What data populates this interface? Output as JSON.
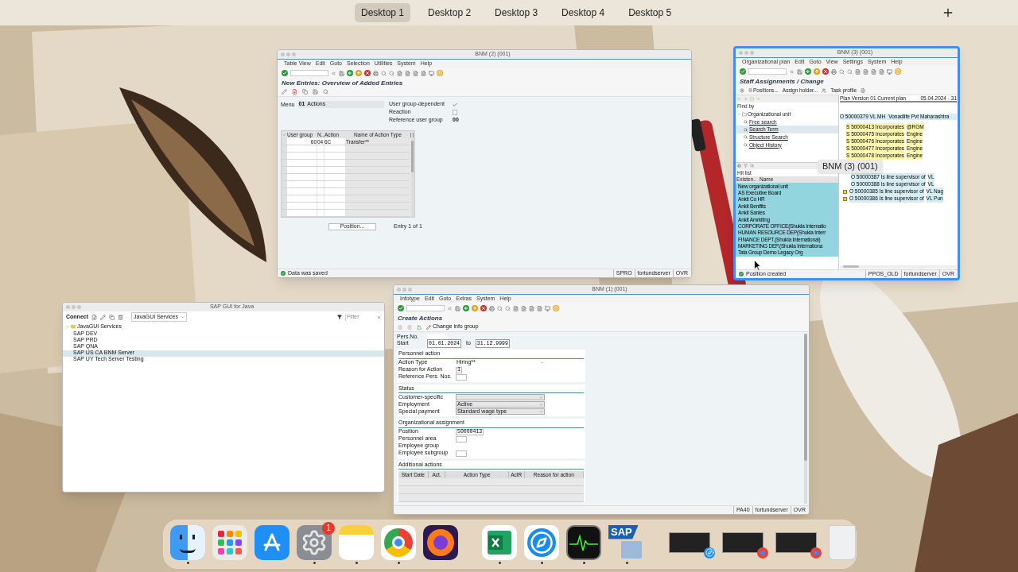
{
  "desktop_bar": {
    "desktops": [
      {
        "label": "Desktop 1",
        "selected": true
      },
      {
        "label": "Desktop 2",
        "selected": false
      },
      {
        "label": "Desktop 3",
        "selected": false
      },
      {
        "label": "Desktop 4",
        "selected": false
      },
      {
        "label": "Desktop 5",
        "selected": false
      }
    ]
  },
  "table_view_window": {
    "title": "BNM (2) (001)",
    "menu": [
      "Table View",
      "Edit",
      "Goto",
      "Selection",
      "Utilities",
      "System",
      "Help"
    ],
    "screen_title": "New Entries: Overview of Added Entries",
    "menu_field": {
      "label": "Menu",
      "code": "01",
      "value": "Actions"
    },
    "options": [
      {
        "kind": "checkbox",
        "label": "User group-dependent",
        "checked": true
      },
      {
        "kind": "checkbox",
        "label": "Reaction",
        "checked": false
      },
      {
        "kind": "text",
        "label": "Reference user group",
        "value": "00"
      }
    ],
    "table": {
      "columns": [
        "User group",
        "N..",
        "Action",
        "Name of Action Type"
      ],
      "rows": [
        [
          "60",
          "04",
          "6C",
          "Transfer**"
        ]
      ]
    },
    "position_button": "Position...",
    "entry_info": "Entry 1 of 1",
    "status_message": "Data was saved",
    "status_items": [
      "SPRO",
      "fortundserver",
      "OVR"
    ]
  },
  "staff_window": {
    "title": "BNM (3) (001)",
    "highlighted": true,
    "hover_label": "BNM (3) (001)",
    "menu": [
      "Organizational plan",
      "Edit",
      "Goto",
      "View",
      "Settings",
      "System",
      "Help"
    ],
    "screen_title": "Staff Assignments / Change",
    "toolbar": [
      "Positions...",
      "Assign holder...",
      "Task profile"
    ],
    "find_by": {
      "heading": "Find by",
      "tree": [
        {
          "label": "Organizational unit",
          "expanded": true,
          "children": [
            {
              "label": "Free search",
              "selected": false
            },
            {
              "label": "Search Term",
              "selected": true
            },
            {
              "label": "Structure Search",
              "selected": false
            },
            {
              "label": "Object History",
              "selected": false
            }
          ]
        }
      ]
    },
    "hit_list": {
      "heading": "Hit list",
      "columns": [
        "Existen..",
        "Name"
      ],
      "rows": [
        "New organizational unit",
        "AS Executive Board",
        "Ankit Co HR",
        "Ankit Benifits",
        "Ankit Sanles",
        "Ankit Amrkiting",
        "CORPORATE OFFICE(Shukla Internatio",
        "HUMAN RESOURCE DEP(Shukla Interr",
        "FINANCE DEPT.(Shukla International)",
        "MARKETING DEP.(Shukla Internationa",
        "Tata Group Demo Legacy Org"
      ]
    },
    "structure": {
      "plan": "Plan Version 01 Current plan",
      "date": "05.04.2024 - 31",
      "root": {
        "type": "O",
        "id": "50000379",
        "short": "VL MH",
        "name": "Vonadlife Pvt Maharashtra"
      },
      "rows": [
        {
          "kind": "position",
          "type": "S",
          "id": "50000413",
          "relation": "Incorporates",
          "name": "@RGM"
        },
        {
          "kind": "position",
          "type": "S",
          "id": "50000475",
          "relation": "Incorporates",
          "name": "Engine"
        },
        {
          "kind": "position",
          "type": "S",
          "id": "50000476",
          "relation": "Incorporates",
          "name": "Engine"
        },
        {
          "kind": "position",
          "type": "S",
          "id": "50000477",
          "relation": "Incorporates",
          "name": "Engine"
        },
        {
          "kind": "position",
          "type": "S",
          "id": "50000478",
          "relation": "Incorporates",
          "name": "Engine"
        },
        {
          "kind": "hidden"
        },
        {
          "kind": "hidden"
        },
        {
          "kind": "sub_unit",
          "type": "O",
          "id": "50000387",
          "relation": "Is line supervisor of",
          "name": "VL"
        },
        {
          "kind": "sub_unit",
          "type": "O",
          "id": "50000388",
          "relation": "Is line supervisor of",
          "name": "VL"
        },
        {
          "kind": "unit",
          "type": "O",
          "id": "50000385",
          "relation": "Is line supervisor of",
          "name": "VL Nag"
        },
        {
          "kind": "unit",
          "type": "O",
          "id": "50000386",
          "relation": "Is line supervisor of",
          "name": "VL Pun"
        }
      ]
    },
    "status_message": "Position created",
    "status_items": [
      "PPOS_OLD",
      "fortundserver",
      "OVR"
    ]
  },
  "create_actions_window": {
    "title": "BNM (1) (001)",
    "menu": [
      "Infotype",
      "Edit",
      "Goto",
      "Extras",
      "System",
      "Help"
    ],
    "screen_title": "Create Actions",
    "toolbar_button": "Change info group",
    "pers_no": {
      "label": "Pers.No."
    },
    "start": {
      "label": "Start",
      "value": "01.01.2024"
    },
    "end": {
      "label": "to",
      "value": "31.12.9999"
    },
    "sections": [
      {
        "title": "Personnel action",
        "fields": [
          {
            "label": "Action Type",
            "kind": "select",
            "value": "Hiring**"
          },
          {
            "label": "Reason for Action",
            "kind": "input",
            "value": "1"
          },
          {
            "label": "Reference Pers. Nos.",
            "kind": "input"
          }
        ]
      },
      {
        "title": "Status",
        "fields": [
          {
            "label": "Customer-specific",
            "kind": "select"
          },
          {
            "label": "Employment",
            "kind": "select",
            "value": "Active"
          },
          {
            "label": "Special payment",
            "kind": "select",
            "value": "Standard wage type"
          }
        ]
      },
      {
        "title": "Organizational assignment",
        "fields": [
          {
            "label": "Position",
            "kind": "input",
            "value": "50000413"
          },
          {
            "label": "Personnel area",
            "kind": "input"
          },
          {
            "label": "Employee group",
            "kind": "label"
          },
          {
            "label": "Employee subgroup",
            "kind": "input"
          }
        ]
      }
    ],
    "additional_actions": {
      "title": "Additional actions",
      "columns": [
        "Start Date",
        "Act.",
        "Action Type",
        "ActR",
        "Reason for action"
      ]
    },
    "status_items": [
      "PA40",
      "fortundserver",
      "OVR"
    ]
  },
  "launcher_window": {
    "title": "SAP GUI for Java",
    "connect": "Connect",
    "service_select": "JavaGUI Services",
    "filter_placeholder": "Filter",
    "tree": [
      {
        "label": "JavaGUI Services",
        "expanded": true,
        "children": [
          {
            "label": "SAP DEV",
            "selected": false
          },
          {
            "label": "SAP PRD",
            "selected": false
          },
          {
            "label": "SAP QNA",
            "selected": false
          },
          {
            "label": "SAP US CA BNM Server",
            "selected": true
          },
          {
            "label": "SAP UY Tech Server Testing",
            "selected": false
          }
        ]
      }
    ]
  },
  "dock": {
    "items": [
      {
        "kind": "finder",
        "running": true
      },
      {
        "kind": "launchpad",
        "running": false
      },
      {
        "kind": "app_store",
        "running": false
      },
      {
        "kind": "settings",
        "running": true,
        "badge": "1"
      },
      {
        "kind": "notes",
        "running": true
      },
      {
        "kind": "chrome",
        "running": true
      },
      {
        "kind": "firefox",
        "running": false
      },
      {
        "kind": "separator"
      },
      {
        "kind": "excel",
        "running": true
      },
      {
        "kind": "safari",
        "running": true
      },
      {
        "kind": "activity_monitor",
        "running": true
      },
      {
        "kind": "sap",
        "running": true,
        "logo_text": "SAP"
      },
      {
        "kind": "separator"
      },
      {
        "kind": "safari_window"
      },
      {
        "kind": "chrome_window"
      },
      {
        "kind": "chrome_window"
      },
      {
        "kind": "trash"
      }
    ]
  }
}
